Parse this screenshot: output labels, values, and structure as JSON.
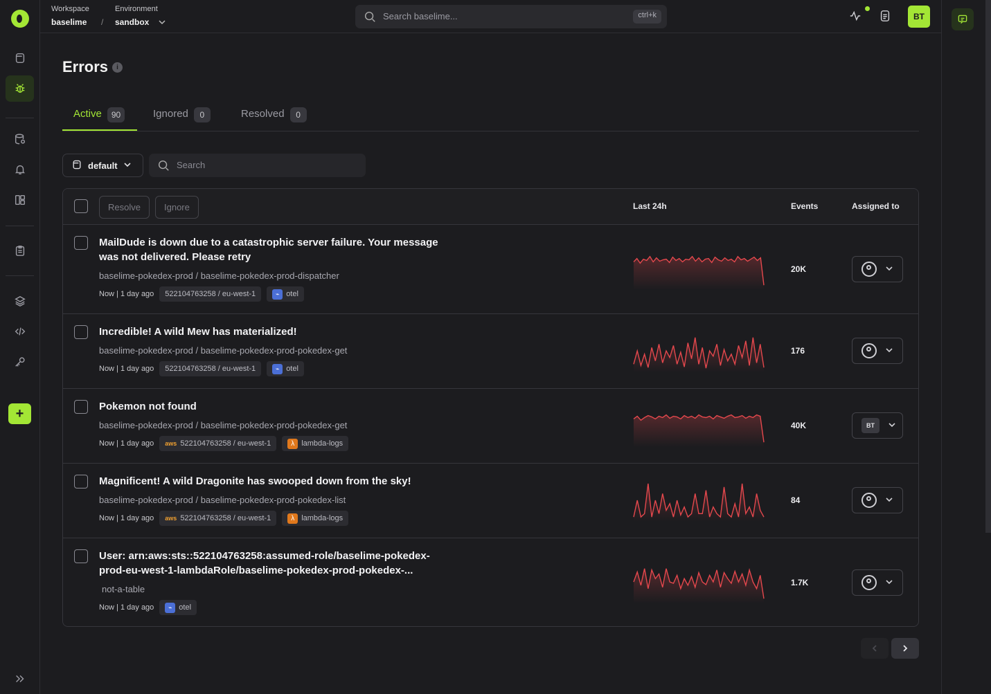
{
  "topbar": {
    "workspace_label": "Workspace",
    "workspace_value": "baselime",
    "environment_label": "Environment",
    "environment_value": "sandbox",
    "search_placeholder": "Search baselime...",
    "search_shortcut": "ctrl+k",
    "avatar_initials": "BT"
  },
  "page": {
    "title": "Errors"
  },
  "tabs": [
    {
      "label": "Active",
      "count": "90"
    },
    {
      "label": "Ignored",
      "count": "0"
    },
    {
      "label": "Resolved",
      "count": "0"
    }
  ],
  "filters": {
    "dataset_label": "default",
    "search_placeholder": "Search"
  },
  "table": {
    "resolve_label": "Resolve",
    "ignore_label": "Ignore",
    "col_last24h": "Last 24h",
    "col_events": "Events",
    "col_assigned": "Assigned to",
    "rows": [
      {
        "title": "MailDude is down due to a catastrophic server failure. Your message was not delivered. Please retry",
        "path": "baselime-pokedex-prod / baselime-pokedex-prod-dispatcher",
        "time": "Now | 1 day ago",
        "account": "522104763258 / eu-west-1",
        "source": "otel",
        "events": "20K",
        "assigned": "",
        "spark": [
          40,
          45,
          38,
          44,
          42,
          48,
          40,
          46,
          41,
          43,
          44,
          39,
          47,
          42,
          45,
          40,
          44,
          43,
          48,
          41,
          46,
          40,
          44,
          45,
          39,
          47,
          43,
          41,
          46,
          42,
          44,
          40,
          48,
          43,
          45,
          41,
          44,
          47,
          42,
          46,
          5
        ]
      },
      {
        "title": "Incredible! A wild Mew has materialized!",
        "path": "baselime-pokedex-prod / baselime-pokedex-prod-pokedex-get",
        "time": "Now | 1 day ago",
        "account": "522104763258 / eu-west-1",
        "source": "otel",
        "events": "176",
        "assigned": "",
        "spark": [
          10,
          30,
          8,
          25,
          5,
          35,
          15,
          40,
          12,
          30,
          20,
          38,
          10,
          28,
          6,
          42,
          18,
          50,
          10,
          35,
          4,
          30,
          22,
          40,
          8,
          32,
          15,
          25,
          10,
          38,
          20,
          45,
          8,
          50,
          12,
          40,
          5
        ]
      },
      {
        "title": "Pokemon not found",
        "path": "baselime-pokedex-prod / baselime-pokedex-prod-pokedex-get",
        "time": "Now | 1 day ago",
        "account": "522104763258 / eu-west-1",
        "source": "lambda-logs",
        "events": "40K",
        "assigned": "BT",
        "spark": [
          40,
          44,
          38,
          42,
          45,
          43,
          40,
          44,
          42,
          46,
          41,
          44,
          43,
          40,
          45,
          42,
          44,
          41,
          46,
          43,
          42,
          44,
          40,
          45,
          43,
          41,
          44,
          46,
          42,
          43,
          45,
          41,
          44,
          42,
          46,
          44,
          5
        ]
      },
      {
        "title": "Magnificent! A wild Dragonite has swooped down from the sky!",
        "path": "baselime-pokedex-prod / baselime-pokedex-prod-pokedex-list",
        "time": "Now | 1 day ago",
        "account": "522104763258 / eu-west-1",
        "source": "lambda-logs",
        "events": "84",
        "assigned": "",
        "spark": [
          5,
          30,
          5,
          10,
          55,
          5,
          30,
          10,
          40,
          15,
          25,
          5,
          30,
          8,
          20,
          5,
          10,
          40,
          10,
          10,
          45,
          5,
          20,
          10,
          5,
          50,
          10,
          5,
          25,
          5,
          55,
          10,
          20,
          5,
          40,
          15,
          5
        ]
      },
      {
        "title": "User: arn:aws:sts::522104763258:assumed-role/baselime-pokedex-prod-eu-west-1-lambdaRole/baselime-pokedex-prod-pokedex-...",
        "path": "not-a-table",
        "time": "Now | 1 day ago",
        "account": "",
        "source": "otel",
        "events": "1.7K",
        "assigned": "",
        "spark": [
          30,
          45,
          25,
          50,
          20,
          48,
          35,
          42,
          22,
          50,
          30,
          28,
          40,
          20,
          35,
          25,
          38,
          22,
          44,
          30,
          26,
          40,
          30,
          48,
          22,
          44,
          35,
          28,
          46,
          30,
          42,
          25,
          48,
          30,
          20,
          40,
          5
        ]
      }
    ]
  },
  "colors": {
    "accent": "#a3e635",
    "spark": "#e5484d"
  }
}
